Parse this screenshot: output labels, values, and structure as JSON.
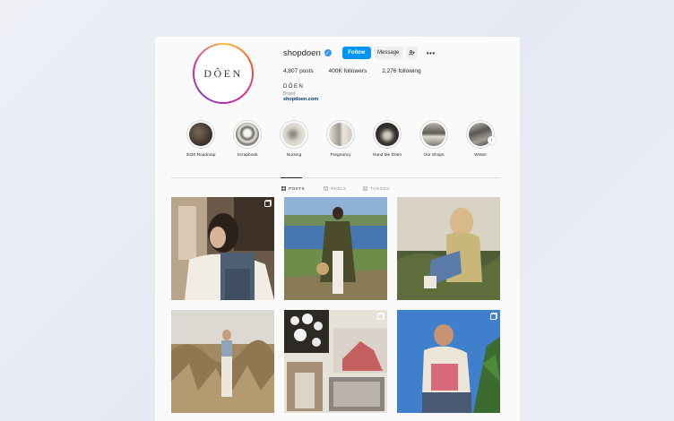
{
  "profile": {
    "username": "shopdoen",
    "avatar_logo": "DÔEN",
    "follow_label": "Follow",
    "message_label": "Message",
    "suggest_icon": "person-plus-icon",
    "more_icon": "more-dots-icon",
    "more_label": "•••",
    "verified_icon": "verified-badge-icon",
    "verified_glyph": "✓",
    "posts": "4,807 posts",
    "followers": "400K followers",
    "following": "2,276 following",
    "bio_name": "DÔEN",
    "bio_category": "Brand",
    "bio_link": "shopdoen.com"
  },
  "highlights": [
    {
      "label": "2030 Roadmap",
      "color": "#4a3f35"
    },
    {
      "label": "Scrapbook",
      "color": "#d9d6cf"
    },
    {
      "label": "Nursing",
      "color": "#cfcac2"
    },
    {
      "label": "Pregnancy",
      "color": "#d8d3ca"
    },
    {
      "label": "Hand Me Dōen",
      "color": "#3e3a35"
    },
    {
      "label": "Our Shops",
      "color": "#9a9590"
    },
    {
      "label": "Winter",
      "color": "#6d6a66"
    }
  ],
  "highlights_next_icon": "chevron-right-icon",
  "highlights_next_glyph": "›",
  "tabs": [
    {
      "label": "POSTS",
      "icon": "grid-icon",
      "active": true
    },
    {
      "label": "REELS",
      "icon": "reels-icon",
      "active": false
    },
    {
      "label": "TAGGED",
      "icon": "tagged-icon",
      "active": false
    }
  ],
  "posts": [
    {
      "subject": "woman in overalls indoors",
      "multi": true
    },
    {
      "subject": "woman in green coat by lake",
      "multi": false
    },
    {
      "subject": "woman in yellow cardigan outdoors",
      "multi": false
    },
    {
      "subject": "woman in field of tall grass",
      "multi": false
    },
    {
      "subject": "collage of flowers and photos",
      "multi": true
    },
    {
      "subject": "woman in cream cardigan with blue sky",
      "multi": true
    }
  ]
}
